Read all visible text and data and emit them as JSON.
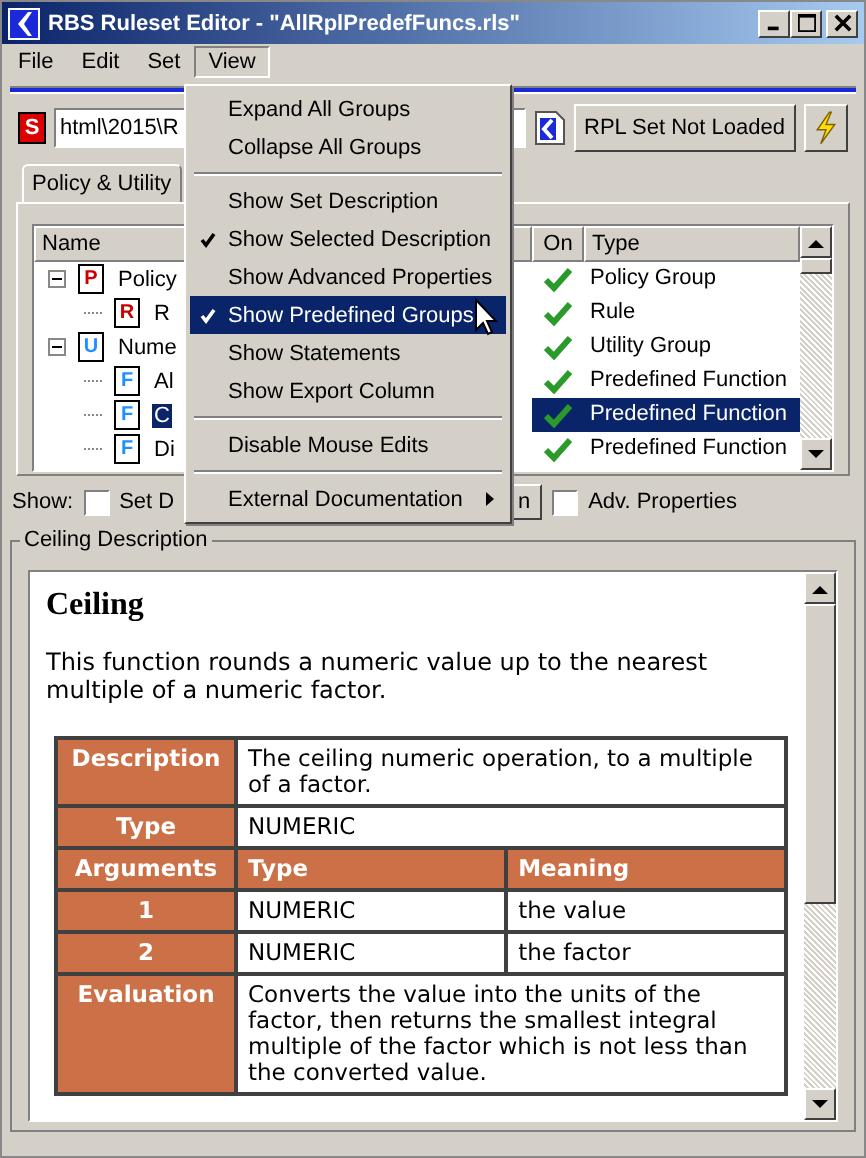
{
  "window": {
    "title": "RBS Ruleset Editor - \"AllRplPredefFuncs.rls\""
  },
  "menu_bar": [
    {
      "label": "File",
      "selected": false
    },
    {
      "label": "Edit",
      "selected": false
    },
    {
      "label": "Set",
      "selected": false
    },
    {
      "label": "View",
      "selected": true
    }
  ],
  "toolbar": {
    "set_icon": "S",
    "path_start": "html\\2015\\R",
    "status_button": "RPL Set Not Loaded"
  },
  "tabs": [
    {
      "label": "Policy & Utility",
      "selected": true
    }
  ],
  "tree": {
    "columns": [
      "Name",
      "On",
      "Type"
    ],
    "rows": [
      {
        "icon": "P",
        "color": "#cc0000",
        "name": "Policy",
        "on": true,
        "type": "Policy Group",
        "selected": false,
        "expanded": true,
        "children": [
          {
            "icon": "R",
            "color": "#cc0000",
            "name": "R",
            "on": true,
            "type": "Rule",
            "selected": false
          }
        ]
      },
      {
        "icon": "U",
        "color": "#1e90ff",
        "name": "Nume",
        "on": true,
        "type": "Utility Group",
        "selected": false,
        "expanded": true,
        "children": [
          {
            "icon": "F",
            "color": "#1e90ff",
            "name": "Al",
            "on": true,
            "type": "Predefined Function",
            "selected": false
          },
          {
            "icon": "F",
            "color": "#1e90ff",
            "name": "C",
            "on": true,
            "type": "Predefined Function",
            "selected": true
          },
          {
            "icon": "F",
            "color": "#1e90ff",
            "name": "Di",
            "on": true,
            "type": "Predefined Function",
            "selected": false
          }
        ]
      }
    ]
  },
  "show_bar": {
    "label": "Show:",
    "options": [
      {
        "label": "Set D",
        "checked": false
      },
      {
        "label": "Adv. Properties",
        "checked": false
      }
    ],
    "button_end": "n"
  },
  "description": {
    "title": "Ceiling Description",
    "heading": "Ceiling",
    "text": "This function rounds a numeric value up to the nearest multiple of a numeric factor.",
    "rows": [
      {
        "kind": "data",
        "label": "Description",
        "cells": [
          {
            "text": "The ceiling numeric operation, to a multiple of a factor.",
            "colspan": 2
          }
        ]
      },
      {
        "kind": "data",
        "label": "Type",
        "cells": [
          {
            "text": "NUMERIC",
            "colspan": 2
          }
        ]
      },
      {
        "kind": "header",
        "label": "Arguments",
        "cells": [
          {
            "text": "Type"
          },
          {
            "text": "Meaning"
          }
        ]
      },
      {
        "kind": "data",
        "label": "1",
        "cells": [
          {
            "text": "NUMERIC"
          },
          {
            "text": "the value"
          }
        ]
      },
      {
        "kind": "data",
        "label": "2",
        "cells": [
          {
            "text": "NUMERIC"
          },
          {
            "text": "the factor"
          }
        ]
      },
      {
        "kind": "data",
        "label": "Evaluation",
        "cells": [
          {
            "text": "Converts the value into the units of the factor, then returns the smallest integral multiple of the factor which is not less than the converted value.",
            "colspan": 2
          }
        ]
      }
    ]
  },
  "view_menu": {
    "items": [
      {
        "kind": "item",
        "label": "Expand All Groups",
        "checked": false,
        "selected": false
      },
      {
        "kind": "item",
        "label": "Collapse All Groups",
        "checked": false,
        "selected": false
      },
      {
        "kind": "separator"
      },
      {
        "kind": "item",
        "label": "Show Set Description",
        "checked": false,
        "selected": false
      },
      {
        "kind": "item",
        "label": "Show Selected Description",
        "checked": true,
        "selected": false
      },
      {
        "kind": "item",
        "label": "Show Advanced Properties",
        "checked": false,
        "selected": false
      },
      {
        "kind": "item",
        "label": "Show Predefined Groups",
        "checked": true,
        "selected": true
      },
      {
        "kind": "item",
        "label": "Show Statements",
        "checked": false,
        "selected": false
      },
      {
        "kind": "item",
        "label": "Show Export Column",
        "checked": false,
        "selected": false
      },
      {
        "kind": "separator"
      },
      {
        "kind": "item",
        "label": "Disable Mouse Edits",
        "checked": false,
        "selected": false
      },
      {
        "kind": "separator"
      },
      {
        "kind": "submenu",
        "label": "External Documentation",
        "checked": false,
        "selected": false
      }
    ]
  }
}
